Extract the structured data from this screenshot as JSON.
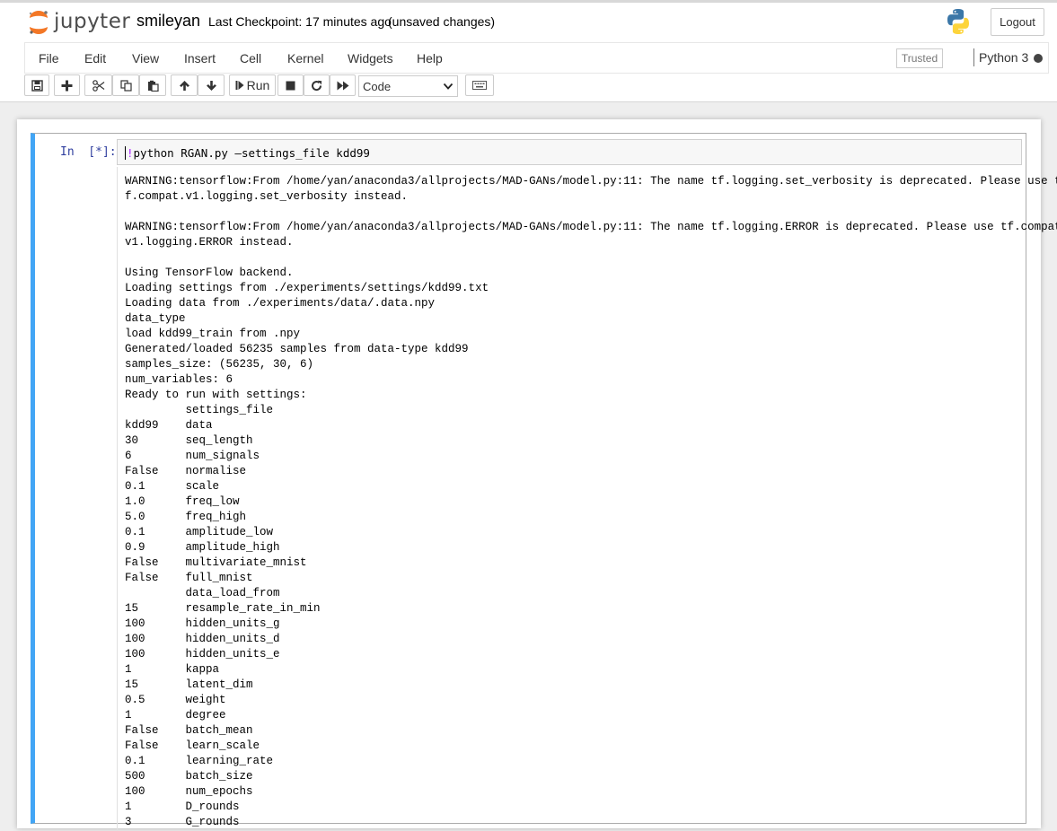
{
  "header": {
    "logo_text": "jupyter",
    "notebook_name": "smileyan",
    "checkpoint": "Last Checkpoint: 17 minutes ago",
    "autosave_status": "(unsaved changes)",
    "logout_label": "Logout",
    "logo_icon": "jupyter-logo-icon",
    "kernel_icon": "python-logo-icon"
  },
  "menubar": {
    "items": [
      "File",
      "Edit",
      "View",
      "Insert",
      "Cell",
      "Kernel",
      "Widgets",
      "Help"
    ],
    "trusted_label": "Trusted",
    "kernel_name": "Python 3"
  },
  "toolbar": {
    "run_label": "Run",
    "cell_type": "Code",
    "icons": [
      "save-icon",
      "plus-icon",
      "cut-icon",
      "copy-icon",
      "paste-icon",
      "arrow-up-icon",
      "arrow-down-icon",
      "step-forward-icon",
      "stop-icon",
      "restart-icon",
      "fast-forward-icon",
      "keyboard-icon"
    ]
  },
  "cell": {
    "prompt": "In  [*]:",
    "code_bang": "!",
    "code_rest": "python RGAN.py —settings_file kdd99",
    "output_lines": [
      "WARNING:tensorflow:From /home/yan/anaconda3/allprojects/MAD-GANs/model.py:11: The name tf.logging.set_verbosity is deprecated. Please use t",
      "f.compat.v1.logging.set_verbosity instead.",
      "",
      "WARNING:tensorflow:From /home/yan/anaconda3/allprojects/MAD-GANs/model.py:11: The name tf.logging.ERROR is deprecated. Please use tf.compat.",
      "v1.logging.ERROR instead.",
      "",
      "Using TensorFlow backend.",
      "Loading settings from ./experiments/settings/kdd99.txt",
      "Loading data from ./experiments/data/.data.npy",
      "data_type",
      "load kdd99_train from .npy",
      "Generated/loaded 56235 samples from data-type kdd99",
      "samples_size: (56235, 30, 6)",
      "num_variables: 6",
      "Ready to run with settings:",
      "         settings_file",
      "kdd99    data",
      "30       seq_length",
      "6        num_signals",
      "False    normalise",
      "0.1      scale",
      "1.0      freq_low",
      "5.0      freq_high",
      "0.1      amplitude_low",
      "0.9      amplitude_high",
      "False    multivariate_mnist",
      "False    full_mnist",
      "         data_load_from",
      "15       resample_rate_in_min",
      "100      hidden_units_g",
      "100      hidden_units_d",
      "100      hidden_units_e",
      "1        kappa",
      "15       latent_dim",
      "0.5      weight",
      "1        degree",
      "False    batch_mean",
      "False    learn_scale",
      "0.1      learning_rate",
      "500      batch_size",
      "100      num_epochs",
      "1        D_rounds",
      "3        G_rounds"
    ]
  },
  "colors": {
    "cell_border_accent": "#42a5f5",
    "prompt_color": "#303f9f",
    "bang_color": "#aa22ff",
    "jupyter_orange": "#f37726"
  }
}
